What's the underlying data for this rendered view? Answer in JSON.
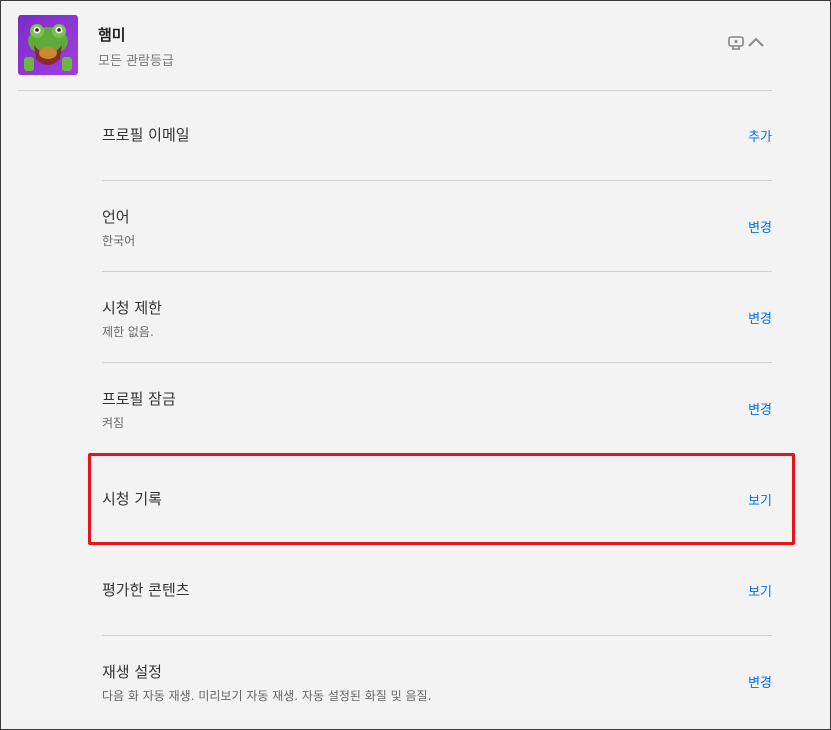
{
  "profile": {
    "name": "햄미",
    "maturity": "모든 관람등급",
    "kids_icon": "kids-profile-icon",
    "toggle_icon": "chevron-up-icon"
  },
  "settings": [
    {
      "title": "프로필 이메일",
      "subtitle": "",
      "action": "추가"
    },
    {
      "title": "언어",
      "subtitle": "한국어",
      "action": "변경"
    },
    {
      "title": "시청 제한",
      "subtitle": "제한 없음.",
      "action": "변경"
    },
    {
      "title": "프로필 잠금",
      "subtitle": "켜짐",
      "action": "변경"
    },
    {
      "title": "시청 기록",
      "subtitle": "",
      "action": "보기"
    },
    {
      "title": "평가한 콘텐츠",
      "subtitle": "",
      "action": "보기"
    },
    {
      "title": "재생 설정",
      "subtitle": "다음 화 자동 재생. 미리보기 자동 재생. 자동 설정된 화질 및 음질.",
      "action": "변경"
    }
  ],
  "colors": {
    "link": "#0071eb",
    "highlight": "#e2161b",
    "background": "#f3f3f3"
  }
}
